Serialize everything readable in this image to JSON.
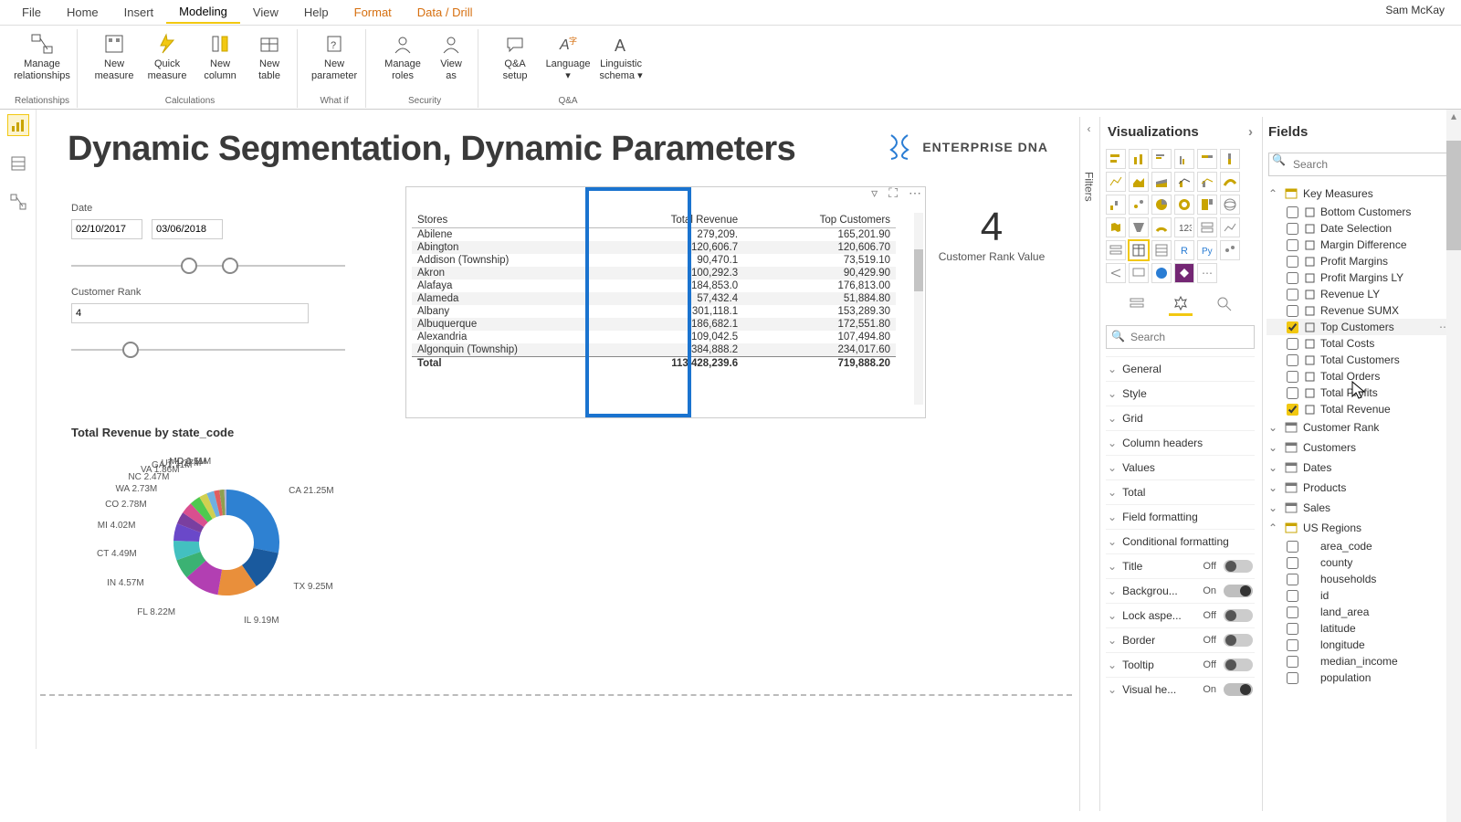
{
  "user": "Sam McKay",
  "menu": {
    "file": "File",
    "home": "Home",
    "insert": "Insert",
    "modeling": "Modeling",
    "view": "View",
    "help": "Help",
    "format": "Format",
    "data": "Data / Drill"
  },
  "ribbon": {
    "manage_rel": "Manage\nrelationships",
    "new_measure": "New\nmeasure",
    "quick_measure": "Quick\nmeasure",
    "new_column": "New\ncolumn",
    "new_table": "New\ntable",
    "new_param": "New\nparameter",
    "manage_roles": "Manage\nroles",
    "view_as": "View\nas",
    "qa_setup": "Q&A\nsetup",
    "language": "Language",
    "ling_schema": "Linguistic\nschema",
    "g_rel": "Relationships",
    "g_calc": "Calculations",
    "g_whatif": "What if",
    "g_sec": "Security",
    "g_qa": "Q&A"
  },
  "title": "Dynamic Segmentation, Dynamic Parameters",
  "logo_text": "ENTERPRISE DNA",
  "date_slicer": {
    "label": "Date",
    "from": "02/10/2017",
    "to": "03/06/2018"
  },
  "rank_slicer": {
    "label": "Customer Rank",
    "value": "4"
  },
  "table": {
    "headers": [
      "Stores",
      "Total Revenue",
      "Top Customers"
    ],
    "rows": [
      [
        "Abilene",
        "279,209.",
        "165,201.90"
      ],
      [
        "Abington",
        "120,606.7",
        "120,606.70"
      ],
      [
        "Addison (Township)",
        "90,470.1",
        "73,519.10"
      ],
      [
        "Akron",
        "100,292.3",
        "90,429.90"
      ],
      [
        "Alafaya",
        "184,853.0",
        "176,813.00"
      ],
      [
        "Alameda",
        "57,432.4",
        "51,884.80"
      ],
      [
        "Albany",
        "301,118.1",
        "153,289.30"
      ],
      [
        "Albuquerque",
        "186,682.1",
        "172,551.80"
      ],
      [
        "Alexandria",
        "109,042.5",
        "107,494.80"
      ],
      [
        "Algonquin (Township)",
        "384,888.2",
        "234,017.60"
      ]
    ],
    "total": [
      "Total",
      "113,428,239.6",
      "719,888.20"
    ]
  },
  "card": {
    "value": "4",
    "caption": "Customer Rank Value"
  },
  "chart_title": "Total Revenue by state_code",
  "chart_data": {
    "type": "pie",
    "title": "Total Revenue by state_code",
    "series": [
      {
        "name": "CA",
        "value": 21.25,
        "label": "CA 21.25M"
      },
      {
        "name": "TX",
        "value": 9.25,
        "label": "TX 9.25M"
      },
      {
        "name": "IL",
        "value": 9.19,
        "label": "IL 9.19M"
      },
      {
        "name": "FL",
        "value": 8.22,
        "label": "FL 8.22M"
      },
      {
        "name": "IN",
        "value": 4.57,
        "label": "IN 4.57M"
      },
      {
        "name": "CT",
        "value": 4.49,
        "label": "CT 4.49M"
      },
      {
        "name": "MI",
        "value": 4.02,
        "label": "MI 4.02M"
      },
      {
        "name": "CO",
        "value": 2.78,
        "label": "CO 2.78M"
      },
      {
        "name": "WA",
        "value": 2.73,
        "label": "WA 2.73M"
      },
      {
        "name": "NC",
        "value": 2.47,
        "label": "NC 2.47M"
      },
      {
        "name": "VA",
        "value": 1.86,
        "label": "VA 1.86M"
      },
      {
        "name": "GA",
        "value": 1.71,
        "label": "GA 1.71M"
      },
      {
        "name": "UT",
        "value": 1.27,
        "label": "UT 1.27M"
      },
      {
        "name": "MO",
        "value": 1.11,
        "label": "MO 1.11M"
      },
      {
        "name": "ID",
        "value": 0.5,
        "label": "ID 0.5M"
      }
    ]
  },
  "viz": {
    "title": "Visualizations",
    "search_ph": "Search",
    "sections": {
      "general": "General",
      "style": "Style",
      "grid": "Grid",
      "colhead": "Column headers",
      "values": "Values",
      "total": "Total",
      "fieldfmt": "Field formatting",
      "condfmt": "Conditional formatting",
      "titlelbl": "Title",
      "bg": "Backgrou...",
      "lock": "Lock aspe...",
      "border": "Border",
      "tooltip": "Tooltip",
      "vishdr": "Visual he..."
    },
    "off": "Off",
    "on": "On"
  },
  "fields": {
    "title": "Fields",
    "search_ph": "Search",
    "key_measures": "Key Measures",
    "measures": [
      {
        "name": "Bottom Customers",
        "checked": false
      },
      {
        "name": "Date Selection",
        "checked": false
      },
      {
        "name": "Margin Difference",
        "checked": false
      },
      {
        "name": "Profit Margins",
        "checked": false
      },
      {
        "name": "Profit Margins LY",
        "checked": false
      },
      {
        "name": "Revenue LY",
        "checked": false
      },
      {
        "name": "Revenue SUMX",
        "checked": false
      },
      {
        "name": "Top Customers",
        "checked": true,
        "hover": true
      },
      {
        "name": "Total Costs",
        "checked": false
      },
      {
        "name": "Total Customers",
        "checked": false
      },
      {
        "name": "Total Orders",
        "checked": false
      },
      {
        "name": "Total Profits",
        "checked": false
      },
      {
        "name": "Total Revenue",
        "checked": true
      }
    ],
    "tables": [
      "Customer Rank",
      "Customers",
      "Dates",
      "Products",
      "Sales",
      "US Regions"
    ],
    "us_fields": [
      "area_code",
      "county",
      "households",
      "id",
      "land_area",
      "latitude",
      "longitude",
      "median_income",
      "population"
    ]
  },
  "filters_label": "Filters"
}
